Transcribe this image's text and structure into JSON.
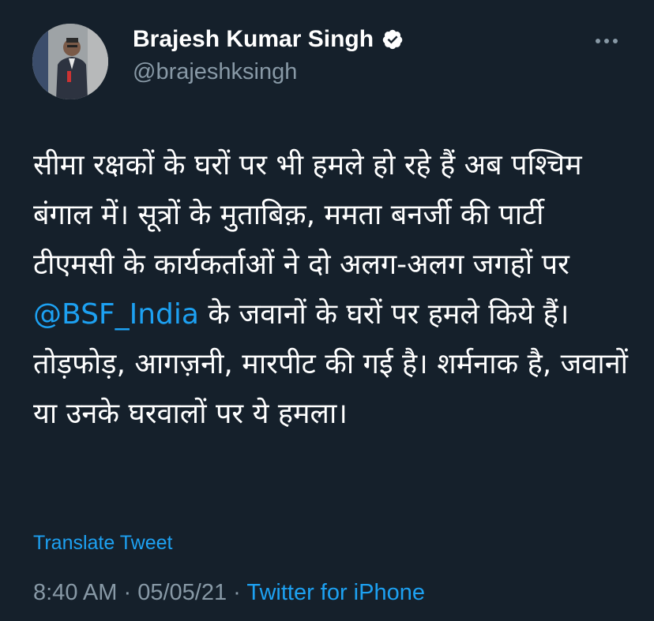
{
  "author": {
    "display_name": "Brajesh Kumar Singh",
    "handle": "@brajeshksingh",
    "verified_icon": "verified-badge-icon",
    "avatar_icon": "avatar"
  },
  "menu": {
    "more_icon": "more-horizontal-icon"
  },
  "tweet": {
    "text_before": "सीमा रक्षकों के घरों पर भी हमले हो रहे हैं अब पश्चिम बंगाल में। सूत्रों के मुताबिक़, ममता बनर्जी की पार्टी टीएमसी के कार्यकर्ताओं ने दो अलग-अलग जगहों पर ",
    "mention": "@BSF_India",
    "text_after": " के जवानों के घरों पर हमले किये हैं। तोड़फोड़, आगज़नी, मारपीट की गई है। शर्मनाक है, जवानों या उनके घरवालों पर ये हमला।",
    "translate_label": "Translate Tweet"
  },
  "meta": {
    "time": "8:40 AM",
    "separator1": " · ",
    "date": "05/05/21",
    "separator2": " · ",
    "source": "Twitter for iPhone"
  },
  "colors": {
    "background": "#15202b",
    "text": "#ffffff",
    "secondary": "#8899a6",
    "accent": "#1da1f2"
  }
}
